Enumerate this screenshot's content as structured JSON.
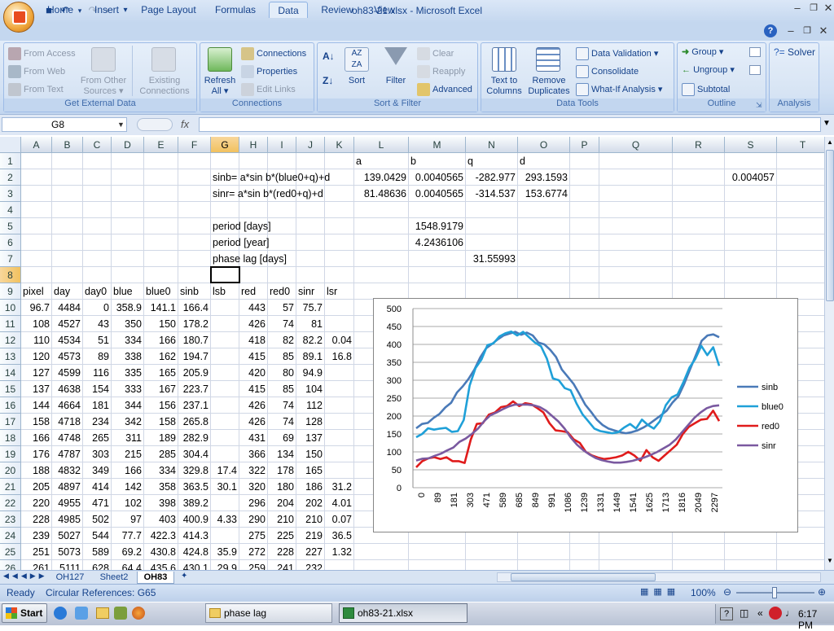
{
  "window": {
    "title": "oh83-21.xlsx - Microsoft Excel"
  },
  "ribbon": {
    "tabs": [
      "Home",
      "Insert",
      "Page Layout",
      "Formulas",
      "Data",
      "Review",
      "View"
    ],
    "active_tab": "Data",
    "groups": {
      "get_external_data": {
        "label": "Get External Data",
        "from_access": "From Access",
        "from_web": "From Web",
        "from_text": "From Text",
        "from_other_sources_1": "From Other",
        "from_other_sources_2": "Sources",
        "existing_connections_1": "Existing",
        "existing_connections_2": "Connections"
      },
      "connections": {
        "label": "Connections",
        "refresh_1": "Refresh",
        "refresh_2": "All",
        "connections": "Connections",
        "properties": "Properties",
        "edit_links": "Edit Links"
      },
      "sort_filter": {
        "label": "Sort & Filter",
        "sort": "Sort",
        "filter": "Filter",
        "clear": "Clear",
        "reapply": "Reapply",
        "advanced": "Advanced"
      },
      "data_tools": {
        "label": "Data Tools",
        "text_to_columns_1": "Text to",
        "text_to_columns_2": "Columns",
        "remove_duplicates_1": "Remove",
        "remove_duplicates_2": "Duplicates",
        "data_validation": "Data Validation",
        "consolidate": "Consolidate",
        "what_if": "What-If Analysis"
      },
      "outline": {
        "label": "Outline",
        "group": "Group",
        "ungroup": "Ungroup",
        "subtotal": "Subtotal"
      },
      "analysis": {
        "label": "Analysis",
        "solver": "Solver"
      }
    }
  },
  "formula_bar": {
    "name_box": "G8",
    "fx": "fx",
    "formula": ""
  },
  "grid": {
    "columns": [
      "A",
      "B",
      "C",
      "D",
      "E",
      "F",
      "G",
      "H",
      "I",
      "J",
      "K",
      "L",
      "M",
      "N",
      "O",
      "P",
      "Q",
      "R",
      "S",
      "T"
    ],
    "selected_column": "G",
    "rows": [
      "1",
      "2",
      "3",
      "4",
      "5",
      "6",
      "7",
      "8",
      "9",
      "10",
      "11",
      "12",
      "13",
      "14",
      "15",
      "16",
      "17",
      "18",
      "19",
      "20",
      "21",
      "22",
      "23",
      "24",
      "25",
      "26"
    ],
    "selected_row": "8",
    "cells": {
      "L1": "a",
      "M1": "b",
      "N1": "q",
      "O1": "d",
      "G2": "sinb= a*sin b*(blue0+q)+d",
      "L2": "139.0429",
      "M2": "0.0040565",
      "N2": "-282.977",
      "O2": "293.1593",
      "S2": "0.004057",
      "G3": "sinr= a*sin b*(red0+q)+d",
      "L3": "81.48636",
      "M3": "0.0040565",
      "N3": "-314.537",
      "O3": "153.6774",
      "G5": "period [days]",
      "M5": "1548.9179",
      "G6": "period [year]",
      "M6": "4.2436106",
      "G7": "phase lag [days]",
      "N7": "31.55993",
      "A9": "pixel",
      "B9": "day",
      "C9": "day0",
      "D9": "blue",
      "E9": "blue0",
      "F9": "sinb",
      "G9": "lsb",
      "H9": "red",
      "I9": "red0",
      "J9": "sinr",
      "K9": "lsr"
    },
    "table_rows": [
      [
        "96.7",
        "4484",
        "0",
        "358.9",
        "141.1",
        "166.4",
        "",
        "443",
        "57",
        "75.7",
        ""
      ],
      [
        "108",
        "4527",
        "43",
        "350",
        "150",
        "178.2",
        "",
        "426",
        "74",
        "81",
        ""
      ],
      [
        "110",
        "4534",
        "51",
        "334",
        "166",
        "180.7",
        "",
        "418",
        "82",
        "82.2",
        "0.04"
      ],
      [
        "120",
        "4573",
        "89",
        "338",
        "162",
        "194.7",
        "",
        "415",
        "85",
        "89.1",
        "16.8"
      ],
      [
        "127",
        "4599",
        "116",
        "335",
        "165",
        "205.9",
        "",
        "420",
        "80",
        "94.9",
        ""
      ],
      [
        "137",
        "4638",
        "154",
        "333",
        "167",
        "223.7",
        "",
        "415",
        "85",
        "104",
        ""
      ],
      [
        "144",
        "4664",
        "181",
        "344",
        "156",
        "237.1",
        "",
        "426",
        "74",
        "112",
        ""
      ],
      [
        "158",
        "4718",
        "234",
        "342",
        "158",
        "265.8",
        "",
        "426",
        "74",
        "128",
        ""
      ],
      [
        "166",
        "4748",
        "265",
        "311",
        "189",
        "282.9",
        "",
        "431",
        "69",
        "137",
        ""
      ],
      [
        "176",
        "4787",
        "303",
        "215",
        "285",
        "304.4",
        "",
        "366",
        "134",
        "150",
        ""
      ],
      [
        "188",
        "4832",
        "349",
        "166",
        "334",
        "329.8",
        "17.4",
        "322",
        "178",
        "165",
        ""
      ],
      [
        "205",
        "4897",
        "414",
        "142",
        "358",
        "363.5",
        "30.1",
        "320",
        "180",
        "186",
        "31.2"
      ],
      [
        "220",
        "4955",
        "471",
        "102",
        "398",
        "389.2",
        "",
        "296",
        "204",
        "202",
        "4.01"
      ],
      [
        "228",
        "4985",
        "502",
        "97",
        "403",
        "400.9",
        "4.33",
        "290",
        "210",
        "210",
        "0.07"
      ],
      [
        "239",
        "5027",
        "544",
        "77.7",
        "422.3",
        "414.3",
        "",
        "275",
        "225",
        "219",
        "36.5"
      ],
      [
        "251",
        "5073",
        "589",
        "69.2",
        "430.8",
        "424.8",
        "35.9",
        "272",
        "228",
        "227",
        "1.32"
      ],
      [
        "261",
        "5111",
        "628",
        "64.4",
        "435.6",
        "430.1",
        "29.9",
        "259",
        "241",
        "232",
        ""
      ]
    ]
  },
  "chart_data": {
    "type": "line",
    "x_ticks": [
      "0",
      "89",
      "181",
      "303",
      "471",
      "589",
      "685",
      "849",
      "991",
      "1086",
      "1239",
      "1331",
      "1449",
      "1541",
      "1625",
      "1713",
      "1816",
      "2049",
      "2297"
    ],
    "ylim": [
      0,
      500
    ],
    "y_ticks": [
      "500",
      "450",
      "400",
      "350",
      "300",
      "250",
      "200",
      "150",
      "100",
      "50",
      "0"
    ],
    "legend_position": "right",
    "series": [
      {
        "name": "sinb",
        "color": "#4a7ab8",
        "values": [
          166,
          178,
          181,
          195,
          206,
          224,
          237,
          266,
          283,
          304,
          330,
          364,
          389,
          401,
          414,
          425,
          430,
          435,
          427,
          433,
          425,
          405,
          400,
          385,
          365,
          330,
          310,
          290,
          262,
          232,
          212,
          190,
          175,
          165,
          160,
          155,
          152,
          155,
          160,
          168,
          178,
          190,
          202,
          215,
          238,
          255,
          290,
          330,
          370,
          410,
          425,
          428,
          420
        ]
      },
      {
        "name": "blue0",
        "color": "#1fa0d8",
        "values": [
          141,
          150,
          166,
          162,
          165,
          167,
          156,
          158,
          189,
          285,
          334,
          358,
          398,
          403,
          422,
          431,
          436,
          425,
          435,
          420,
          405,
          395,
          360,
          305,
          300,
          278,
          272,
          235,
          205,
          185,
          165,
          158,
          155,
          152,
          155,
          168,
          178,
          165,
          190,
          175,
          165,
          185,
          230,
          252,
          260,
          295,
          335,
          360,
          396,
          370,
          392,
          340
        ]
      },
      {
        "name": "red0",
        "color": "#e01b1b",
        "values": [
          57,
          74,
          82,
          85,
          80,
          85,
          74,
          74,
          69,
          134,
          178,
          180,
          204,
          210,
          225,
          228,
          241,
          228,
          236,
          233,
          222,
          210,
          180,
          160,
          158,
          155,
          135,
          125,
          100,
          90,
          84,
          80,
          82,
          85,
          90,
          100,
          90,
          75,
          105,
          85,
          75,
          90,
          105,
          120,
          150,
          170,
          180,
          190,
          192,
          215,
          186
        ]
      },
      {
        "name": "sinr",
        "color": "#7a59a0",
        "values": [
          76,
          81,
          82,
          89,
          95,
          104,
          112,
          128,
          137,
          150,
          165,
          186,
          202,
          210,
          219,
          227,
          232,
          232,
          232,
          230,
          225,
          215,
          200,
          185,
          165,
          140,
          120,
          105,
          93,
          83,
          77,
          73,
          70,
          70,
          72,
          75,
          80,
          85,
          92,
          100,
          110,
          120,
          135,
          155,
          175,
          195,
          210,
          222,
          228,
          230
        ]
      }
    ]
  },
  "sheet_tabs": [
    "OH127",
    "Sheet2",
    "OH83"
  ],
  "active_sheet": "OH83",
  "status": {
    "ready": "Ready",
    "circular": "Circular References: G65",
    "zoom": "100%"
  },
  "taskbar": {
    "start": "Start",
    "items": [
      "phase lag",
      "oh83-21.xlsx"
    ],
    "clock": "6:17 PM"
  }
}
